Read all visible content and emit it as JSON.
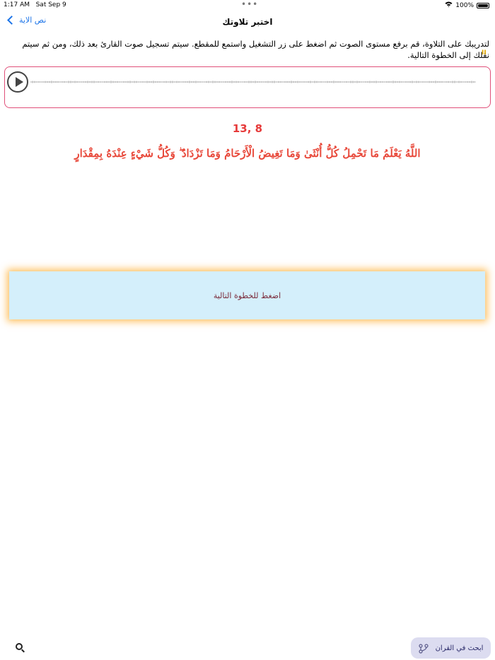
{
  "status_bar": {
    "time": "1:17 AM",
    "date": "Sat Sep 9",
    "dots": "•••",
    "battery": "100%",
    "wifi_icon": "wifi-icon",
    "battery_icon": "battery-icon"
  },
  "nav": {
    "title": "اختبر تلاوتك",
    "back_label": "نص الاية",
    "back_icon": "chevron-left-icon",
    "accent": "#1a73e8"
  },
  "instructions": "لتدريبك على التلاوة، قم برفع مستوى الصوت ثم اضغط على زر التشغيل واستمع للمقطع. سيتم تسجيل صوت القارئ بعد ذلك، ومن ثم سيتم نقلك إلى الخطوة التالية.",
  "pause_symbol": "II",
  "player": {
    "border_color": "#e0507a",
    "play_icon": "play-icon"
  },
  "verse": {
    "reference": "13, 8",
    "text": "اللَّهُ يَعْلَمُ مَا تَحْمِلُ كُلُّ أُنْثَىٰ وَمَا تَغِيضُ الْأَرْحَامُ وَمَا تَزْدَادُ ۖ وَكُلُّ شَيْءٍ عِنْدَهُ بِمِقْدَارٍ",
    "color": "#e8483a"
  },
  "next_button": {
    "label": "اضغط للخطوة التالية",
    "background": "#d4effb",
    "glow": "#ffaa28"
  },
  "bottom": {
    "search_icon": "search-icon",
    "quran_search_label": "ابحث في القران",
    "quran_search_icon": "branch-icon"
  }
}
